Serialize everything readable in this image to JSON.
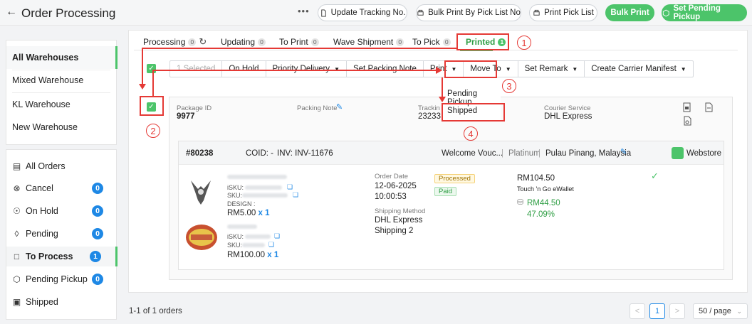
{
  "header": {
    "back_icon": "arrow-left-icon",
    "title": "Order Processing",
    "more": "•••",
    "buttons": {
      "update_tracking": "Update Tracking No.",
      "bulk_print_pick": "Bulk Print By Pick List No",
      "print_pick_list": "Print Pick List",
      "bulk_print": "Bulk Print",
      "set_pending_pickup": "Set Pending Pickup"
    }
  },
  "warehouses": [
    {
      "label": "All Warehouses"
    },
    {
      "label": "Mixed Warehouse"
    },
    {
      "label": "KL Warehouse"
    },
    {
      "label": "New Warehouse"
    }
  ],
  "statuses": [
    {
      "label": "All Orders",
      "icon": "inbox-icon",
      "count": ""
    },
    {
      "label": "Cancel",
      "icon": "cancel-icon",
      "count": "0"
    },
    {
      "label": "On Hold",
      "icon": "pause-icon",
      "count": "0"
    },
    {
      "label": "Pending",
      "icon": "layers-icon",
      "count": "0"
    },
    {
      "label": "To Process",
      "icon": "clipboard-icon",
      "count": "1"
    },
    {
      "label": "Pending Pickup",
      "icon": "box-icon",
      "count": "0"
    },
    {
      "label": "Shipped",
      "icon": "truck-icon",
      "count": ""
    }
  ],
  "tabs": [
    {
      "label": "Processing",
      "count": "0"
    },
    {
      "label": "Updating",
      "count": "0"
    },
    {
      "label": "To Print",
      "count": "0"
    },
    {
      "label": "Wave Shipment",
      "count": "0"
    },
    {
      "label": "To Pick",
      "count": "0"
    },
    {
      "label": "Printed",
      "count": "1"
    }
  ],
  "actions": {
    "selected": "1 Selected",
    "on_hold": "On Hold",
    "priority_delivery": "Priority Delivery",
    "set_packing_note": "Set Packing Note",
    "print": "Print",
    "move_to": "Move To",
    "set_remark": "Set Remark",
    "create_carrier_manifest": "Create Carrier Manifest"
  },
  "move_to_menu": {
    "pending_pickup": "Pending Pickup",
    "shipped": "Shipped"
  },
  "package": {
    "id_label": "Package ID",
    "id": "9977",
    "note_label": "Packing Note",
    "tracking_label": "Trackin",
    "tracking": "23233",
    "courier_label": "Courier Service",
    "courier": "DHL Express"
  },
  "order": {
    "number": "#80238",
    "coid": "COID: -",
    "inv_label": "INV:",
    "inv": "INV-11676",
    "voucher": "Welcome Vouc...",
    "tier": "Platinum",
    "location": "Pulau Pinang, Malaysia",
    "store": "Webstore",
    "items": [
      {
        "isku": "iSKU:",
        "sku": "SKU:",
        "design": "DESIGN :",
        "price": "RM5.00",
        "qty": "x 1"
      },
      {
        "isku": "iSKU:",
        "sku": "SKU:",
        "price": "RM100.00",
        "qty": "x 1"
      }
    ],
    "order_date_label": "Order Date",
    "order_date": "12-06-2025",
    "order_time": "10:00:53",
    "shipping_label": "Shipping Method",
    "shipping_method": "DHL Express",
    "shipping_method_2": "Shipping 2",
    "status_tag": "Processed",
    "payment_tag": "Paid",
    "amount": "RM104.50",
    "payment_method": "Touch 'n Go eWallet",
    "profit": "RM44.50",
    "profit_pct": "47.09%"
  },
  "annotations": [
    "1",
    "2",
    "3",
    "4"
  ],
  "footer": {
    "count": "1-1 of 1 orders",
    "prev": "<",
    "page": "1",
    "next": ">",
    "page_size": "50 / page"
  },
  "colors": {
    "accent": "#4cc46a",
    "badge": "#1e88e5",
    "annotation": "#e53935"
  }
}
